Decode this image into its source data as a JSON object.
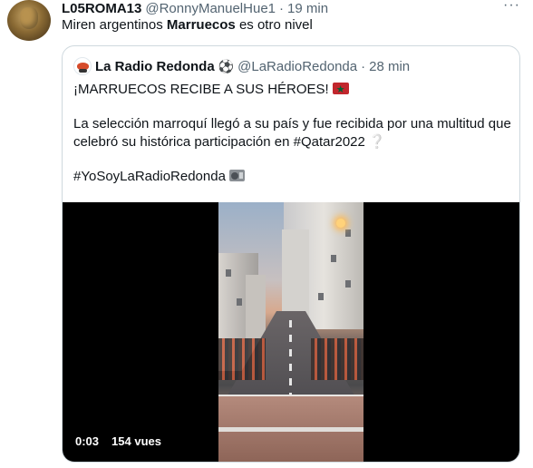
{
  "tweet": {
    "author_name": "L05ROMA13",
    "author_handle": "@RonnyManuelHue1",
    "separator": "·",
    "time": "19 min",
    "more_label": "···",
    "text_before": "Miren argentinos ",
    "text_bold": "Marruecos",
    "text_after": " es otro nivel"
  },
  "quoted": {
    "author_name": "La Radio Redonda",
    "author_emoji": "⚽",
    "author_handle": "@LaRadioRedonda",
    "separator": "·",
    "time": "28 min",
    "line1": "¡MARRUECOS RECIBE A SUS HÉROES!",
    "line2": "La selección marroquí llegó a su país y fue recibida por una multitud que celebró su histórica participación en #Qatar2022",
    "line2_emoji": "❔",
    "line3": "#YoSoyLaRadioRedonda",
    "video": {
      "elapsed": "0:03",
      "views": "154 vues"
    }
  },
  "icons": {
    "more": "more-horizontal-icon",
    "flag": "morocco-flag-icon",
    "radio": "radio-icon",
    "ball": "soccer-ball-icon"
  }
}
